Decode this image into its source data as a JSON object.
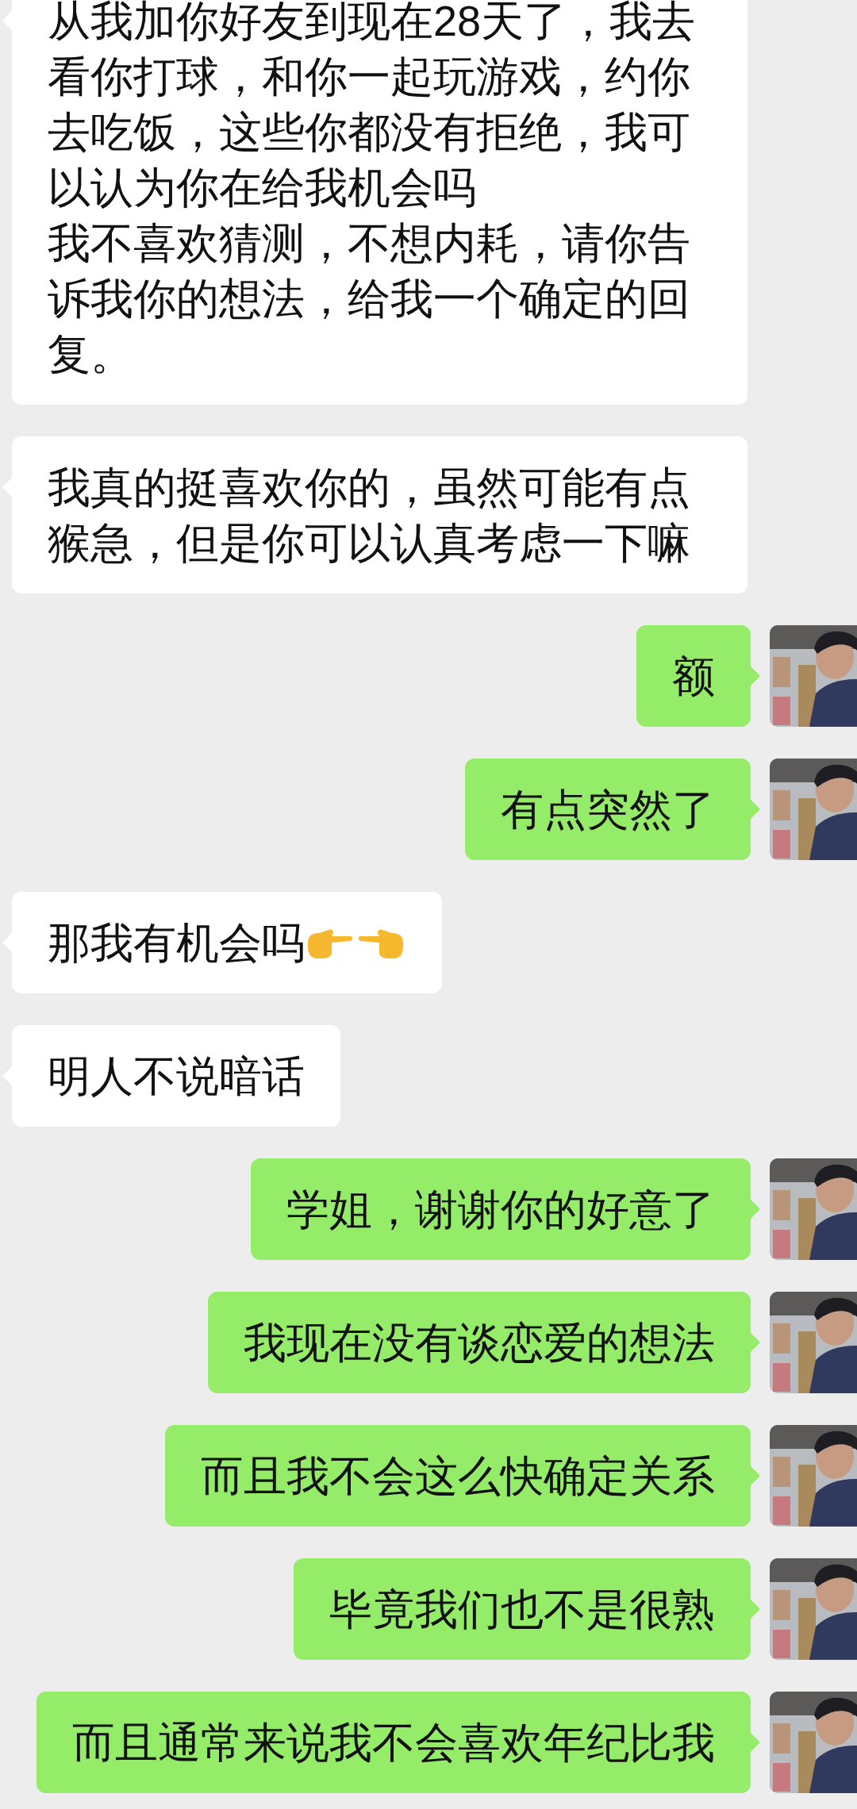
{
  "messages": [
    {
      "sent": false,
      "kind": "text",
      "paragraphs": [
        "从我加你好友到现在28天了，我去看你打球，和你一起玩游戏，约你去吃饭，这些你都没有拒绝，我可以认为你在给我机会吗",
        "我不喜欢猜测，不想内耗，请你告诉我你的想法，给我一个确定的回复。"
      ]
    },
    {
      "sent": false,
      "kind": "text",
      "paragraphs": [
        "我真的挺喜欢你的，虽然可能有点猴急，但是你可以认真考虑一下嘛"
      ]
    },
    {
      "sent": true,
      "kind": "text",
      "paragraphs": [
        "额"
      ]
    },
    {
      "sent": true,
      "kind": "text",
      "paragraphs": [
        "有点突然了"
      ]
    },
    {
      "sent": false,
      "kind": "hands",
      "paragraphs": [
        "那我有机会吗"
      ]
    },
    {
      "sent": false,
      "kind": "text",
      "paragraphs": [
        "明人不说暗话"
      ]
    },
    {
      "sent": true,
      "kind": "text",
      "paragraphs": [
        "学姐，谢谢你的好意了"
      ]
    },
    {
      "sent": true,
      "kind": "text",
      "paragraphs": [
        "我现在没有谈恋爱的想法"
      ]
    },
    {
      "sent": true,
      "kind": "text",
      "paragraphs": [
        "而且我不会这么快确定关系"
      ]
    },
    {
      "sent": true,
      "kind": "text",
      "paragraphs": [
        "毕竟我们也不是很熟"
      ]
    },
    {
      "sent": true,
      "kind": "text",
      "paragraphs": [
        "而且通常来说我不会喜欢年纪比我"
      ]
    }
  ]
}
